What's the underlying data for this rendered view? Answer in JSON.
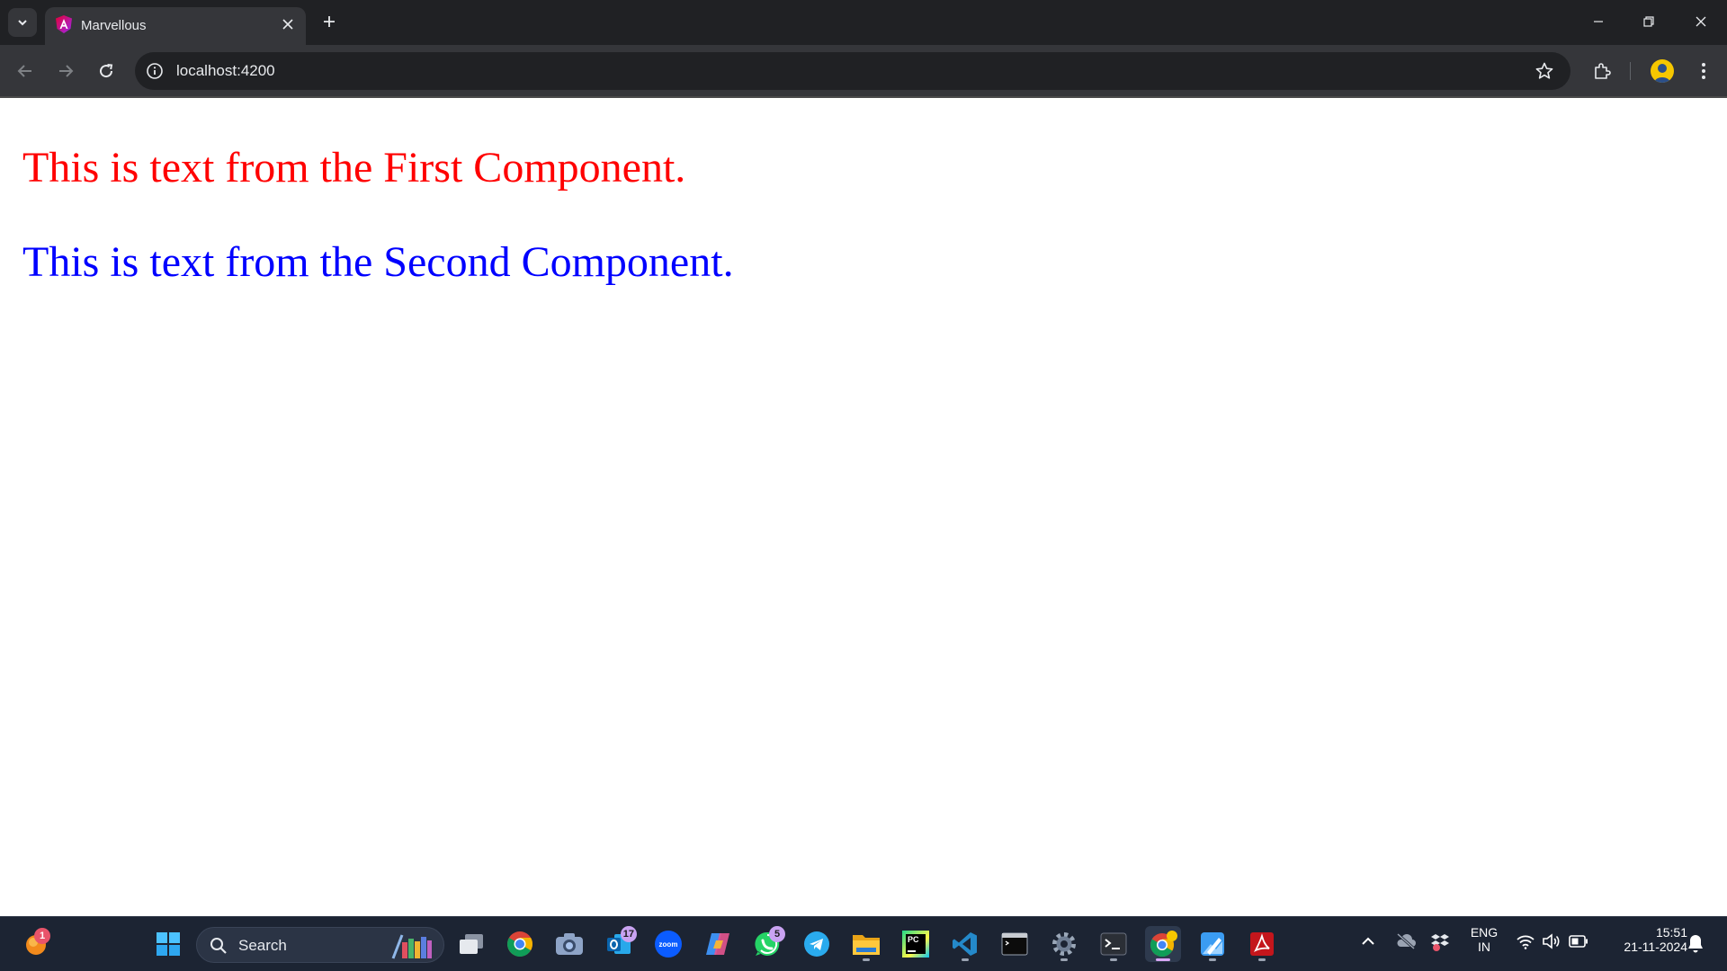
{
  "browser": {
    "tab_title": "Marvellous",
    "url": "localhost:4200"
  },
  "page": {
    "first_component_text": "This is text from the First Component.",
    "second_component_text": "This is text from the Second Component.",
    "first_color": "#ff0000",
    "second_color": "#0000ff"
  },
  "taskbar": {
    "weather_badge": "1",
    "search_label": "Search",
    "outlook_badge": "17",
    "whatsapp_badge": "5",
    "zoom_label": "zoom",
    "pycharm_label": "PC",
    "language_line1": "ENG",
    "language_line2": "IN",
    "time": "15:51",
    "date": "21-11-2024"
  },
  "icons": {
    "tab_search": "chevron-down-icon",
    "tab_close": "close-icon",
    "new_tab": "plus-icon",
    "back": "arrow-left-icon",
    "forward": "arrow-right-icon",
    "reload": "reload-icon",
    "site_info": "info-icon",
    "bookmark": "star-icon",
    "extensions": "puzzle-icon",
    "menu": "kebab-menu-icon"
  }
}
